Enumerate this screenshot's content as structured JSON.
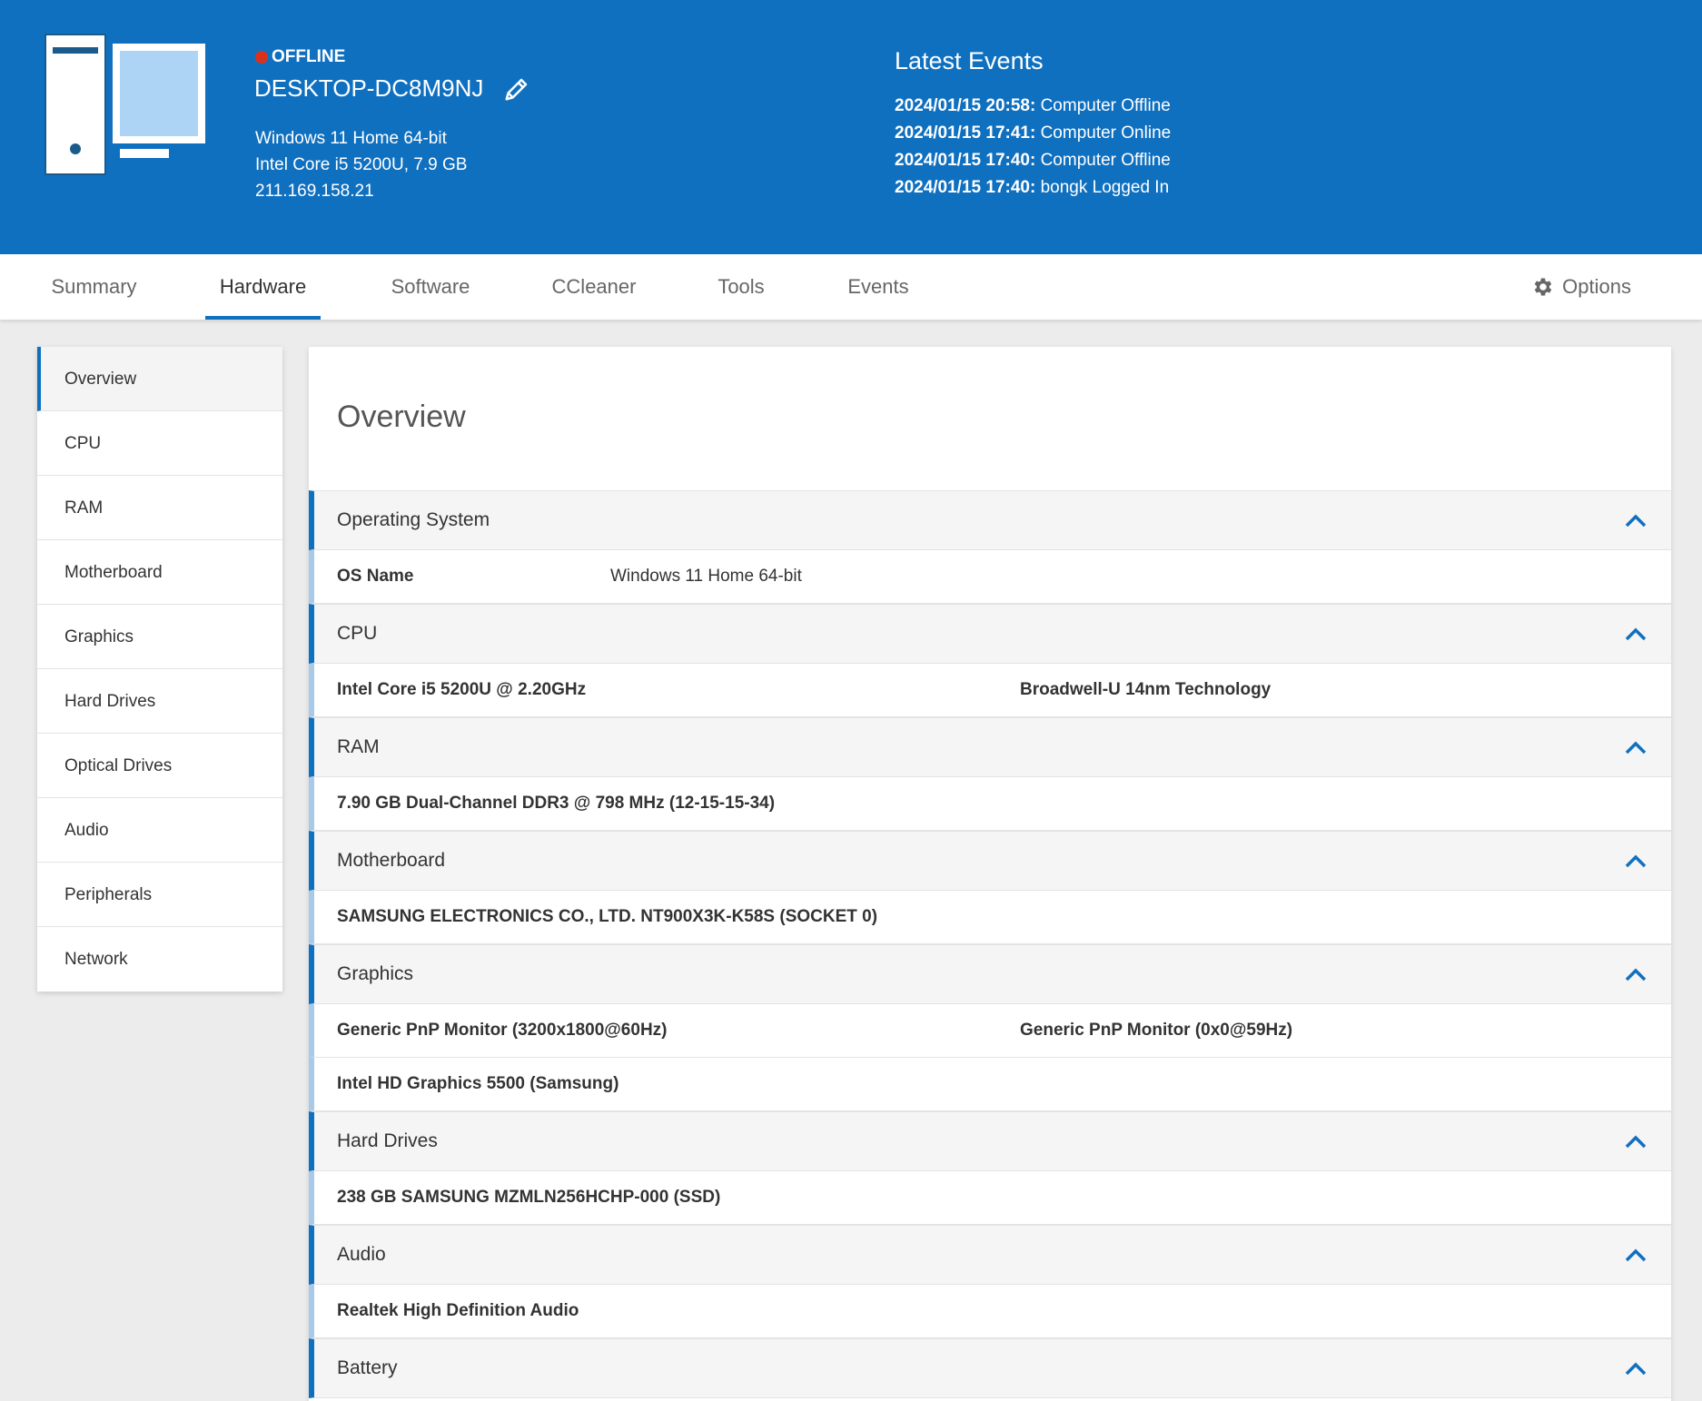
{
  "header": {
    "status": "OFFLINE",
    "status_color": "#d8321e",
    "computer_name": "DESKTOP-DC8M9NJ",
    "specs": [
      "Windows 11 Home 64-bit",
      "Intel Core i5 5200U, 7.9 GB",
      "211.169.158.21"
    ],
    "events_title": "Latest Events",
    "events": [
      {
        "time": "2024/01/15 20:58:",
        "text": " Computer Offline"
      },
      {
        "time": "2024/01/15 17:41:",
        "text": " Computer Online"
      },
      {
        "time": "2024/01/15 17:40:",
        "text": " Computer Offline"
      },
      {
        "time": "2024/01/15 17:40:",
        "text": " bongk Logged In"
      }
    ]
  },
  "tabs": [
    "Summary",
    "Hardware",
    "Software",
    "CCleaner",
    "Tools",
    "Events"
  ],
  "active_tab": "Hardware",
  "options_label": "Options",
  "sidebar": [
    "Overview",
    "CPU",
    "RAM",
    "Motherboard",
    "Graphics",
    "Hard Drives",
    "Optical Drives",
    "Audio",
    "Peripherals",
    "Network"
  ],
  "panel_title": "Overview",
  "sections": {
    "os": {
      "title": "Operating System",
      "label": "OS Name",
      "value": "Windows 11 Home 64-bit"
    },
    "cpu": {
      "title": "CPU",
      "col1": "Intel Core i5 5200U @ 2.20GHz",
      "col2": "Broadwell-U 14nm Technology"
    },
    "ram": {
      "title": "RAM",
      "value": "7.90 GB Dual-Channel DDR3 @ 798 MHz (12-15-15-34)"
    },
    "motherboard": {
      "title": "Motherboard",
      "value": "SAMSUNG ELECTRONICS CO., LTD. NT900X3K-K58S (SOCKET 0)"
    },
    "graphics": {
      "title": "Graphics",
      "monitor1": "Generic PnP Monitor (3200x1800@60Hz)",
      "monitor2": "Generic PnP Monitor (0x0@59Hz)",
      "adapter": "Intel HD Graphics 5500 (Samsung)"
    },
    "hdd": {
      "title": "Hard Drives",
      "value": "238 GB SAMSUNG MZMLN256HCHP-000 (SSD)"
    },
    "audio": {
      "title": "Audio",
      "value": "Realtek High Definition Audio"
    },
    "battery": {
      "title": "Battery"
    }
  },
  "colors": {
    "accent": "#1070c0",
    "header_bg": "#1070c0",
    "offline": "#d8321e"
  }
}
